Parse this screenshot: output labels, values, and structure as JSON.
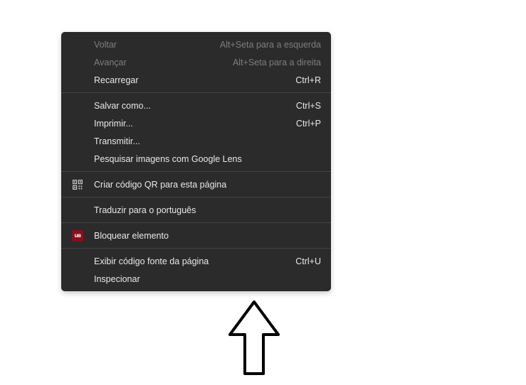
{
  "menu": {
    "groups": [
      [
        {
          "label": "Voltar",
          "shortcut": "Alt+Seta para a esquerda",
          "disabled": true,
          "icon": null
        },
        {
          "label": "Avançar",
          "shortcut": "Alt+Seta para a direita",
          "disabled": true,
          "icon": null
        },
        {
          "label": "Recarregar",
          "shortcut": "Ctrl+R",
          "disabled": false,
          "icon": null
        }
      ],
      [
        {
          "label": "Salvar como...",
          "shortcut": "Ctrl+S",
          "disabled": false,
          "icon": null
        },
        {
          "label": "Imprimir...",
          "shortcut": "Ctrl+P",
          "disabled": false,
          "icon": null
        },
        {
          "label": "Transmitir...",
          "shortcut": "",
          "disabled": false,
          "icon": null
        },
        {
          "label": "Pesquisar imagens com Google Lens",
          "shortcut": "",
          "disabled": false,
          "icon": null
        }
      ],
      [
        {
          "label": "Criar código QR para esta página",
          "shortcut": "",
          "disabled": false,
          "icon": "qr"
        }
      ],
      [
        {
          "label": "Traduzir para o português",
          "shortcut": "",
          "disabled": false,
          "icon": null
        }
      ],
      [
        {
          "label": "Bloquear elemento",
          "shortcut": "",
          "disabled": false,
          "icon": "ublock"
        }
      ],
      [
        {
          "label": "Exibir código fonte da página",
          "shortcut": "Ctrl+U",
          "disabled": false,
          "icon": null
        },
        {
          "label": "Inspecionar",
          "shortcut": "",
          "disabled": false,
          "icon": null
        }
      ]
    ]
  },
  "ublock_text": "uʙ",
  "arrow_annotation": "up-arrow"
}
